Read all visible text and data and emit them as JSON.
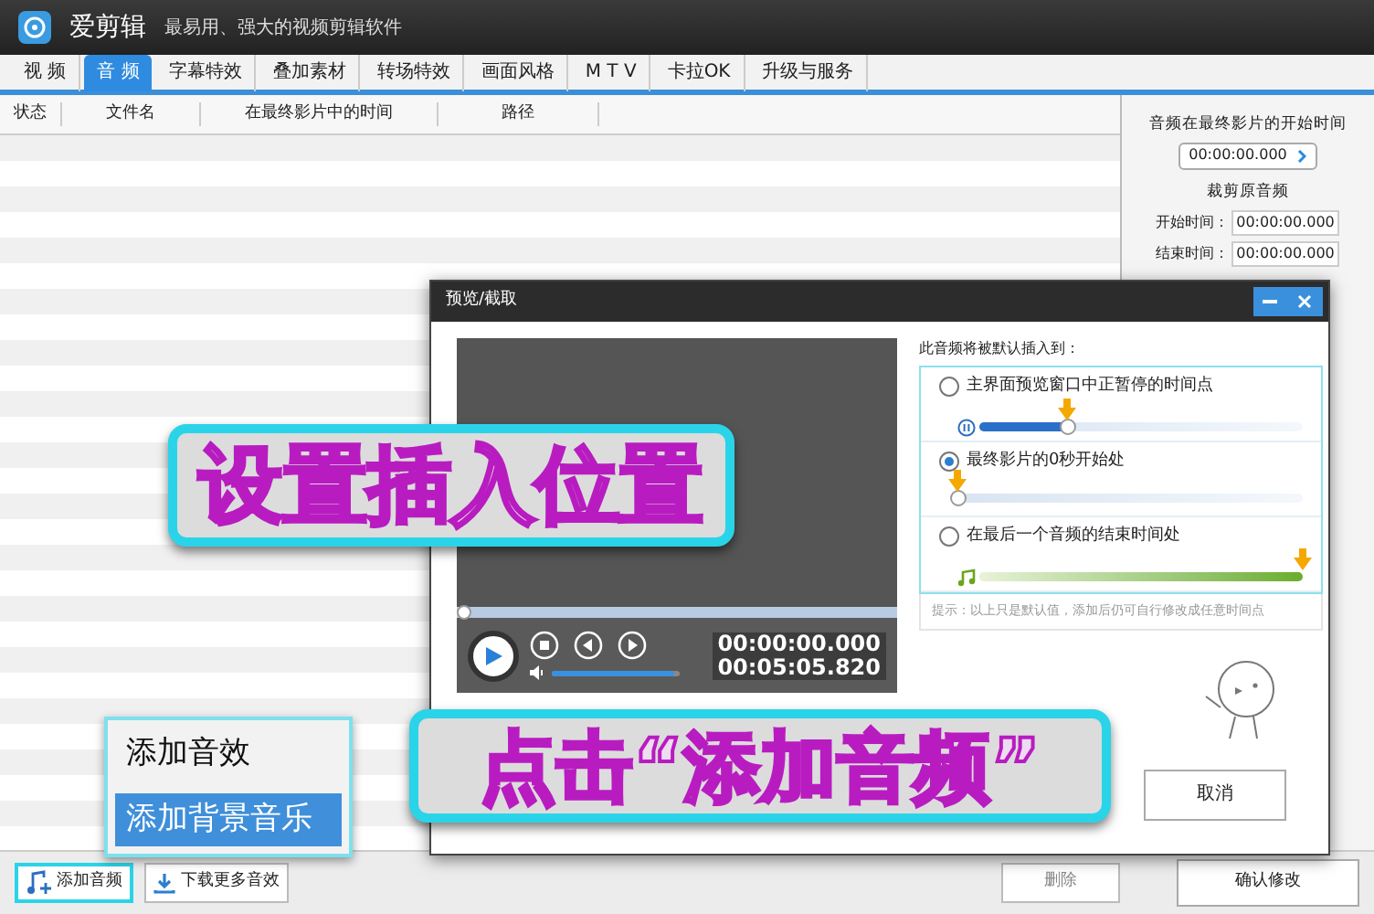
{
  "app": {
    "name": "爱剪辑",
    "slogan": "最易用、强大的视频剪辑软件"
  },
  "tabs": [
    {
      "label": "视 频",
      "selected": false
    },
    {
      "label": "音 频",
      "selected": true
    },
    {
      "label": "字幕特效",
      "selected": false
    },
    {
      "label": "叠加素材",
      "selected": false
    },
    {
      "label": "转场特效",
      "selected": false
    },
    {
      "label": "画面风格",
      "selected": false
    },
    {
      "label": "M T V",
      "selected": false
    },
    {
      "label": "卡拉OK",
      "selected": false
    },
    {
      "label": "升级与服务",
      "selected": false
    }
  ],
  "table": {
    "columns": [
      "状态",
      "文件名",
      "在最终影片中的时间",
      "路径"
    ]
  },
  "side_panel": {
    "start_title": "音频在最终影片的开始时间",
    "start_value": "00:00:00.000",
    "trim_title": "裁剪原音频",
    "fields": [
      {
        "label": "开始时间：",
        "value": "00:00:00.000"
      },
      {
        "label": "结束时间：",
        "value": "00:00:00.000"
      }
    ]
  },
  "bottom_bar": {
    "buttons": [
      {
        "label": "添加音频",
        "kind": "add"
      },
      {
        "label": "下载更多音效",
        "kind": "download"
      }
    ],
    "delete": "删除",
    "confirm": "确认修改"
  },
  "menu": {
    "items": [
      {
        "label": "添加音效",
        "selected": false
      },
      {
        "label": "添加背景音乐",
        "selected": true
      }
    ]
  },
  "dialog": {
    "title": "预览/截取",
    "current_time": "00:00:00.000",
    "total_time": "00:05:05.820",
    "volume": {
      "level": 0.95
    },
    "progress": {
      "level": 0
    },
    "insert_title": "此音频将被默认插入到：",
    "options": [
      {
        "label": "主界面预览窗口中正暂停的时间点",
        "selected": false,
        "kind": "pause",
        "level": 0.27
      },
      {
        "label": "最终影片的0秒开始处",
        "selected": true,
        "kind": "start",
        "level": 0
      },
      {
        "label": "在最后一个音频的结束时间处",
        "selected": false,
        "kind": "end",
        "level": 1
      }
    ],
    "hint": "提示：以上只是默认值，添加后仍可自行修改成任意时间点",
    "cancel": "取消"
  },
  "callouts": [
    "设置插入位置",
    "点击“添加音频”"
  ]
}
